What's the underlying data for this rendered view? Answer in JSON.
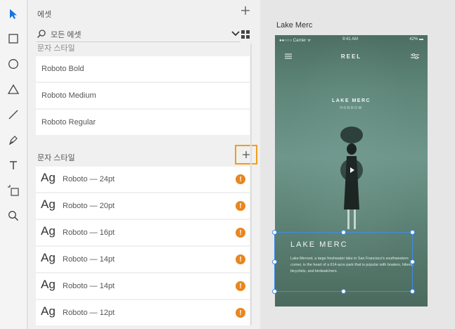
{
  "toolbar": {
    "tools": [
      "select-tool",
      "rectangle-tool",
      "ellipse-tool",
      "polygon-tool",
      "line-tool",
      "pen-tool",
      "text-tool",
      "artboard-tool",
      "zoom-tool"
    ]
  },
  "assets": {
    "title": "에셋",
    "search_placeholder": "모든 에셋",
    "partial_heading": "문자 스타일",
    "fonts": [
      "Roboto Bold",
      "Roboto Medium",
      "Roboto Regular"
    ],
    "char_styles_label": "문자 스타일",
    "char_styles": [
      {
        "ag": "Ag",
        "label": "Roboto — 24pt"
      },
      {
        "ag": "Ag",
        "label": "Roboto — 20pt"
      },
      {
        "ag": "Ag",
        "label": "Roboto — 16pt"
      },
      {
        "ag": "Ag",
        "label": "Roboto — 14pt"
      },
      {
        "ag": "Ag",
        "label": "Roboto — 14pt"
      },
      {
        "ag": "Ag",
        "label": "Roboto — 12pt"
      }
    ],
    "warning_glyph": "!",
    "colors": {
      "warning": "#e8861f",
      "highlight": "#f29d1b",
      "selection": "#3e8de6",
      "accent": "#1473e6"
    }
  },
  "canvas": {
    "artboard_label": "Lake Merc",
    "status": {
      "carrier": "●●○○○ Carrier ᯤ",
      "time": "9:41 AM",
      "battery": "42% ▬"
    },
    "brand": "REEL",
    "hero_title": "LAKE MERC",
    "hero_subtitle": "HORROW",
    "card_title": "LAKE MERC",
    "card_body": "Lake Merced, a large freshwater lake in San Francisco's southwestern corner, is the heart of a 614-acre park that is popular with boaters, hikers, bicyclists, and birdwatchers."
  }
}
